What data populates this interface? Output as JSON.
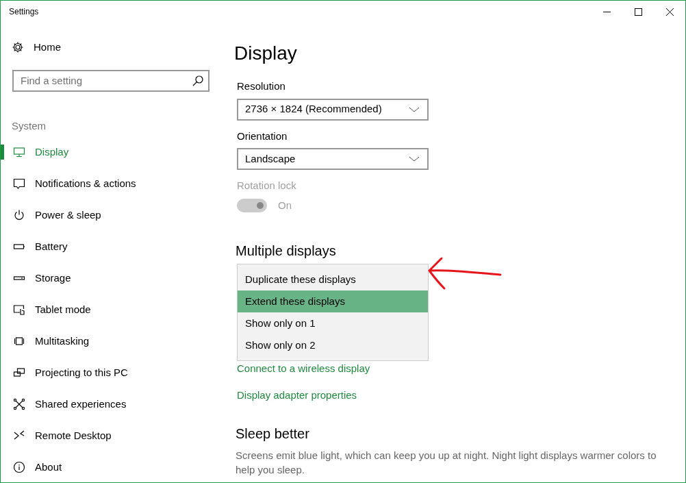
{
  "window": {
    "title": "Settings"
  },
  "sidebar": {
    "home": "Home",
    "search": {
      "placeholder": "Find a setting"
    },
    "section": "System",
    "items": [
      {
        "label": "Display",
        "selected": true
      },
      {
        "label": "Notifications & actions",
        "selected": false
      },
      {
        "label": "Power & sleep",
        "selected": false
      },
      {
        "label": "Battery",
        "selected": false
      },
      {
        "label": "Storage",
        "selected": false
      },
      {
        "label": "Tablet mode",
        "selected": false
      },
      {
        "label": "Multitasking",
        "selected": false
      },
      {
        "label": "Projecting to this PC",
        "selected": false
      },
      {
        "label": "Shared experiences",
        "selected": false
      },
      {
        "label": "Remote Desktop",
        "selected": false
      },
      {
        "label": "About",
        "selected": false
      }
    ]
  },
  "page": {
    "title": "Display",
    "resolution": {
      "label": "Resolution",
      "value": "2736 × 1824 (Recommended)"
    },
    "orientation": {
      "label": "Orientation",
      "value": "Landscape"
    },
    "rotation_lock": {
      "label": "Rotation lock",
      "on": true,
      "disabled": true,
      "state_text": "On"
    },
    "multiple_displays": {
      "heading": "Multiple displays",
      "options": [
        {
          "label": "Duplicate these displays",
          "selected": false
        },
        {
          "label": "Extend these displays",
          "selected": true
        },
        {
          "label": "Show only on 1",
          "selected": false
        },
        {
          "label": "Show only on 2",
          "selected": false
        }
      ]
    },
    "links": [
      "Connect to a wireless display",
      "Display adapter properties"
    ],
    "sleep_better": {
      "heading": "Sleep better",
      "text": "Screens emit blue light, which can keep you up at night. Night light displays warmer colors to help you sleep."
    }
  }
}
